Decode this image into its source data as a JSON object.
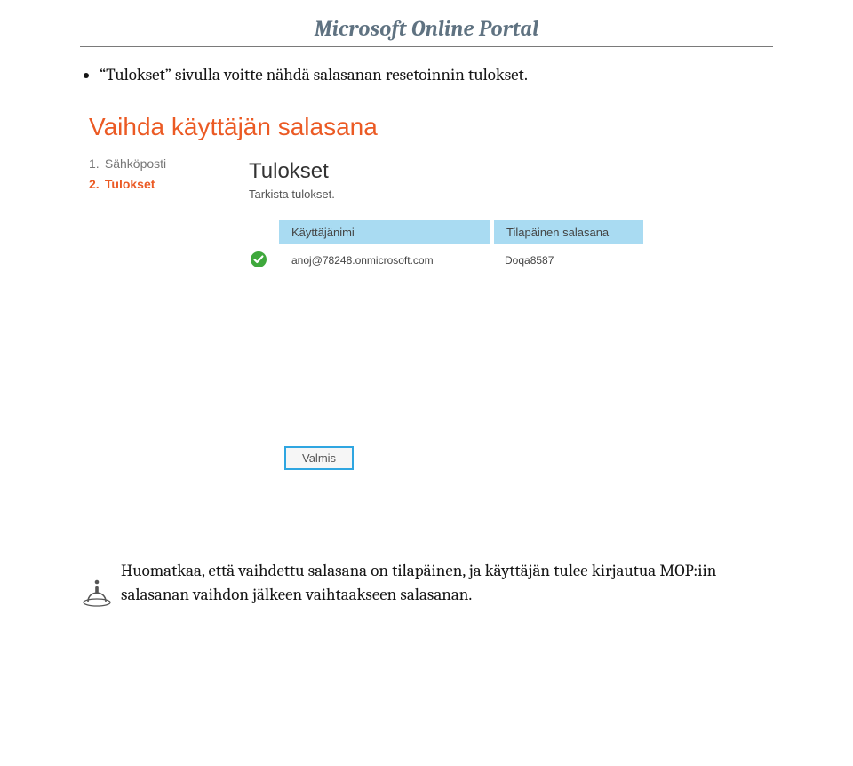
{
  "doc": {
    "title": "Microsoft Online Portal",
    "intro_item": "“Tulokset” sivulla voitte nähdä salasanan resetoinnin tulokset.",
    "note": " Huomatkaa, että vaihdettu salasana on tilapäinen, ja käyttäjän tulee kirjautua MOP:iin salasanan vaihdon jälkeen vaihtaakseen salasanan."
  },
  "wizard": {
    "title": "Vaihda käyttäjän salasana",
    "steps": {
      "step1_num": "1.",
      "step1_label": "Sähköposti",
      "step2_num": "2.",
      "step2_label": "Tulokset"
    },
    "panel": {
      "heading": "Tulokset",
      "subtext": "Tarkista tulokset."
    },
    "table": {
      "col_user": "Käyttäjänimi",
      "col_temp": "Tilapäinen salasana",
      "row1": {
        "user": "anoj@78248.onmicrosoft.com",
        "temp": "Doqa8587"
      }
    },
    "finish_label": "Valmis"
  }
}
